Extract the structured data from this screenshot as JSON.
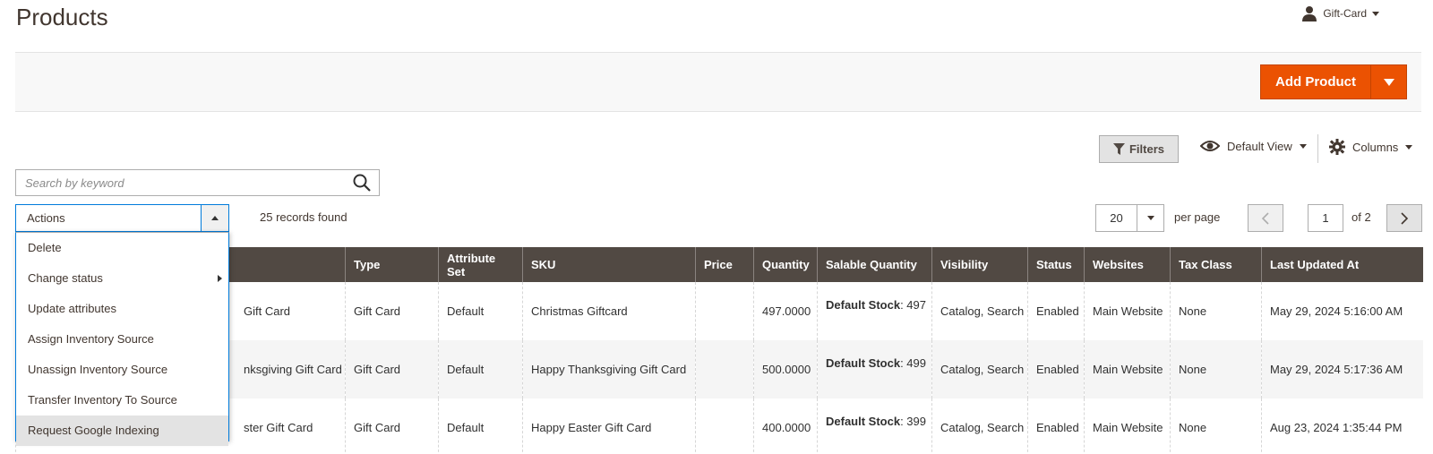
{
  "page": {
    "title": "Products"
  },
  "user": {
    "name": "Gift-Card"
  },
  "header_actions": {
    "add_product": "Add Product"
  },
  "toolbar": {
    "filters": "Filters",
    "view": "Default View",
    "columns": "Columns",
    "search_placeholder": "Search by keyword",
    "actions_label": "Actions",
    "records_found": "25 records found",
    "per_page_value": "20",
    "per_page_label": "per page",
    "current_page": "1",
    "of_pages": "of 2"
  },
  "actions_menu": {
    "items": [
      "Delete",
      "Change status",
      "Update attributes",
      "Assign Inventory Source",
      "Unassign Inventory Source",
      "Transfer Inventory To Source",
      "Request Google Indexing"
    ],
    "highlighted_index": 6
  },
  "grid": {
    "columns": [
      "Type",
      "Attribute Set",
      "SKU",
      "Price",
      "Quantity",
      "Salable Quantity",
      "Visibility",
      "Status",
      "Websites",
      "Tax Class",
      "Last Updated At"
    ],
    "rows": [
      {
        "name": "Gift Card",
        "type": "Gift Card",
        "attribute_set": "Default",
        "sku": "Christmas Giftcard",
        "price": "",
        "quantity": "497.0000",
        "salable_source": "Default Stock",
        "salable_qty": ": 497",
        "visibility": "Catalog, Search",
        "status": "Enabled",
        "websites": "Main Website",
        "tax_class": "None",
        "updated": "May 29, 2024 5:16:00 AM"
      },
      {
        "name": "nksgiving Gift Card",
        "type": "Gift Card",
        "attribute_set": "Default",
        "sku": "Happy Thanksgiving Gift Card",
        "price": "",
        "quantity": "500.0000",
        "salable_source": "Default Stock",
        "salable_qty": ": 499",
        "visibility": "Catalog, Search",
        "status": "Enabled",
        "websites": "Main Website",
        "tax_class": "None",
        "updated": "May 29, 2024 5:17:36 AM"
      },
      {
        "name": "ster Gift Card",
        "type": "Gift Card",
        "attribute_set": "Default",
        "sku": "Happy Easter Gift Card",
        "price": "",
        "quantity": "400.0000",
        "salable_source": "Default Stock",
        "salable_qty": ": 399",
        "visibility": "Catalog, Search",
        "status": "Enabled",
        "websites": "Main Website",
        "tax_class": "None",
        "updated": "Aug 23, 2024 1:35:44 PM"
      }
    ]
  }
}
